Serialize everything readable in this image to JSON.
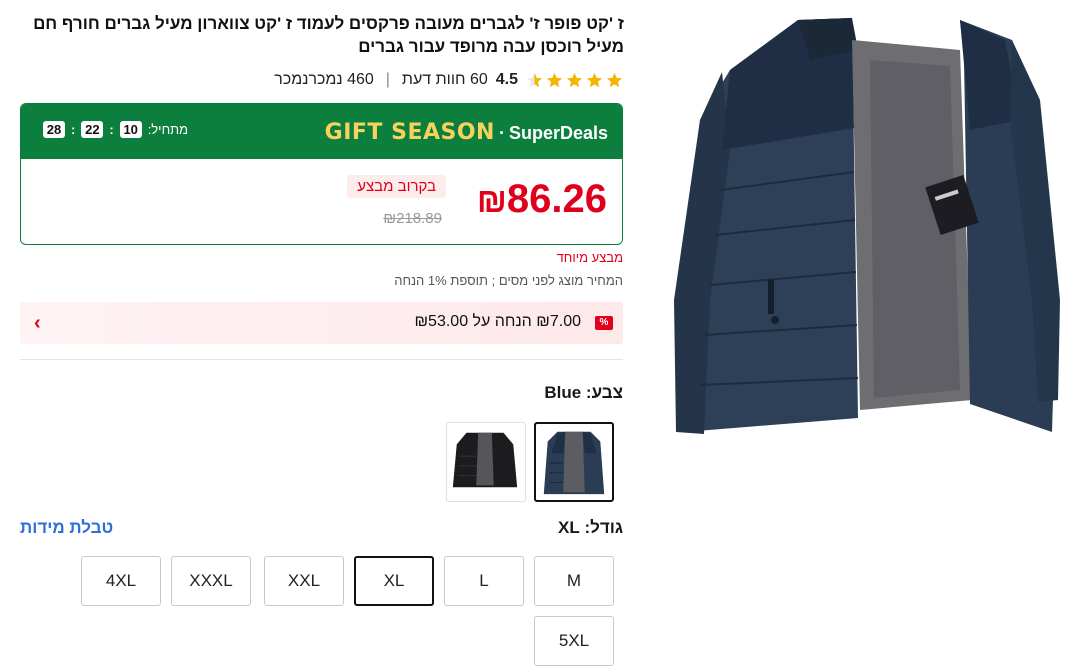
{
  "product": {
    "title": "ז 'קט פופר ז' לגברים מעובה פרקסים לעמוד ז 'קט צווארון מעיל גברים חורף חם מעיל רוכסן עבה מרופד עבור גברים",
    "rating": "4.5",
    "reviews": "60 חוות דעת",
    "sold": "460 נמכרנמכר"
  },
  "deal": {
    "brand_gift": "GIFT SEASON",
    "brand_sd": "SuperDeals",
    "starts_label": "מתחיל:",
    "hours": "10",
    "minutes": "22",
    "seconds": "28",
    "price": "86.26",
    "currency": "₪",
    "coming_soon": "בקרוב מבצע",
    "old_price": "₪218.89"
  },
  "special_deal": "מבצע מיוחד",
  "tax_note": "המחיר מוצג לפני מסים ; תוספת 1% הנחה",
  "discount": {
    "text": "₪7.00 הנחה על ₪53.00",
    "icon": "%"
  },
  "color": {
    "label": "צבע: Blue",
    "options": [
      "Blue",
      "Black"
    ],
    "selected": "Blue"
  },
  "size": {
    "label": "גודל: XL",
    "chart_link": "טבלת מידות",
    "options": [
      "M",
      "L",
      "XL",
      "XXL",
      "XXXL",
      "4XL",
      "5XL"
    ],
    "selected": "XL"
  },
  "colors": {
    "accent_red": "#e0001b",
    "deal_green": "#0c7e3d",
    "link_blue": "#2e6fdc"
  }
}
